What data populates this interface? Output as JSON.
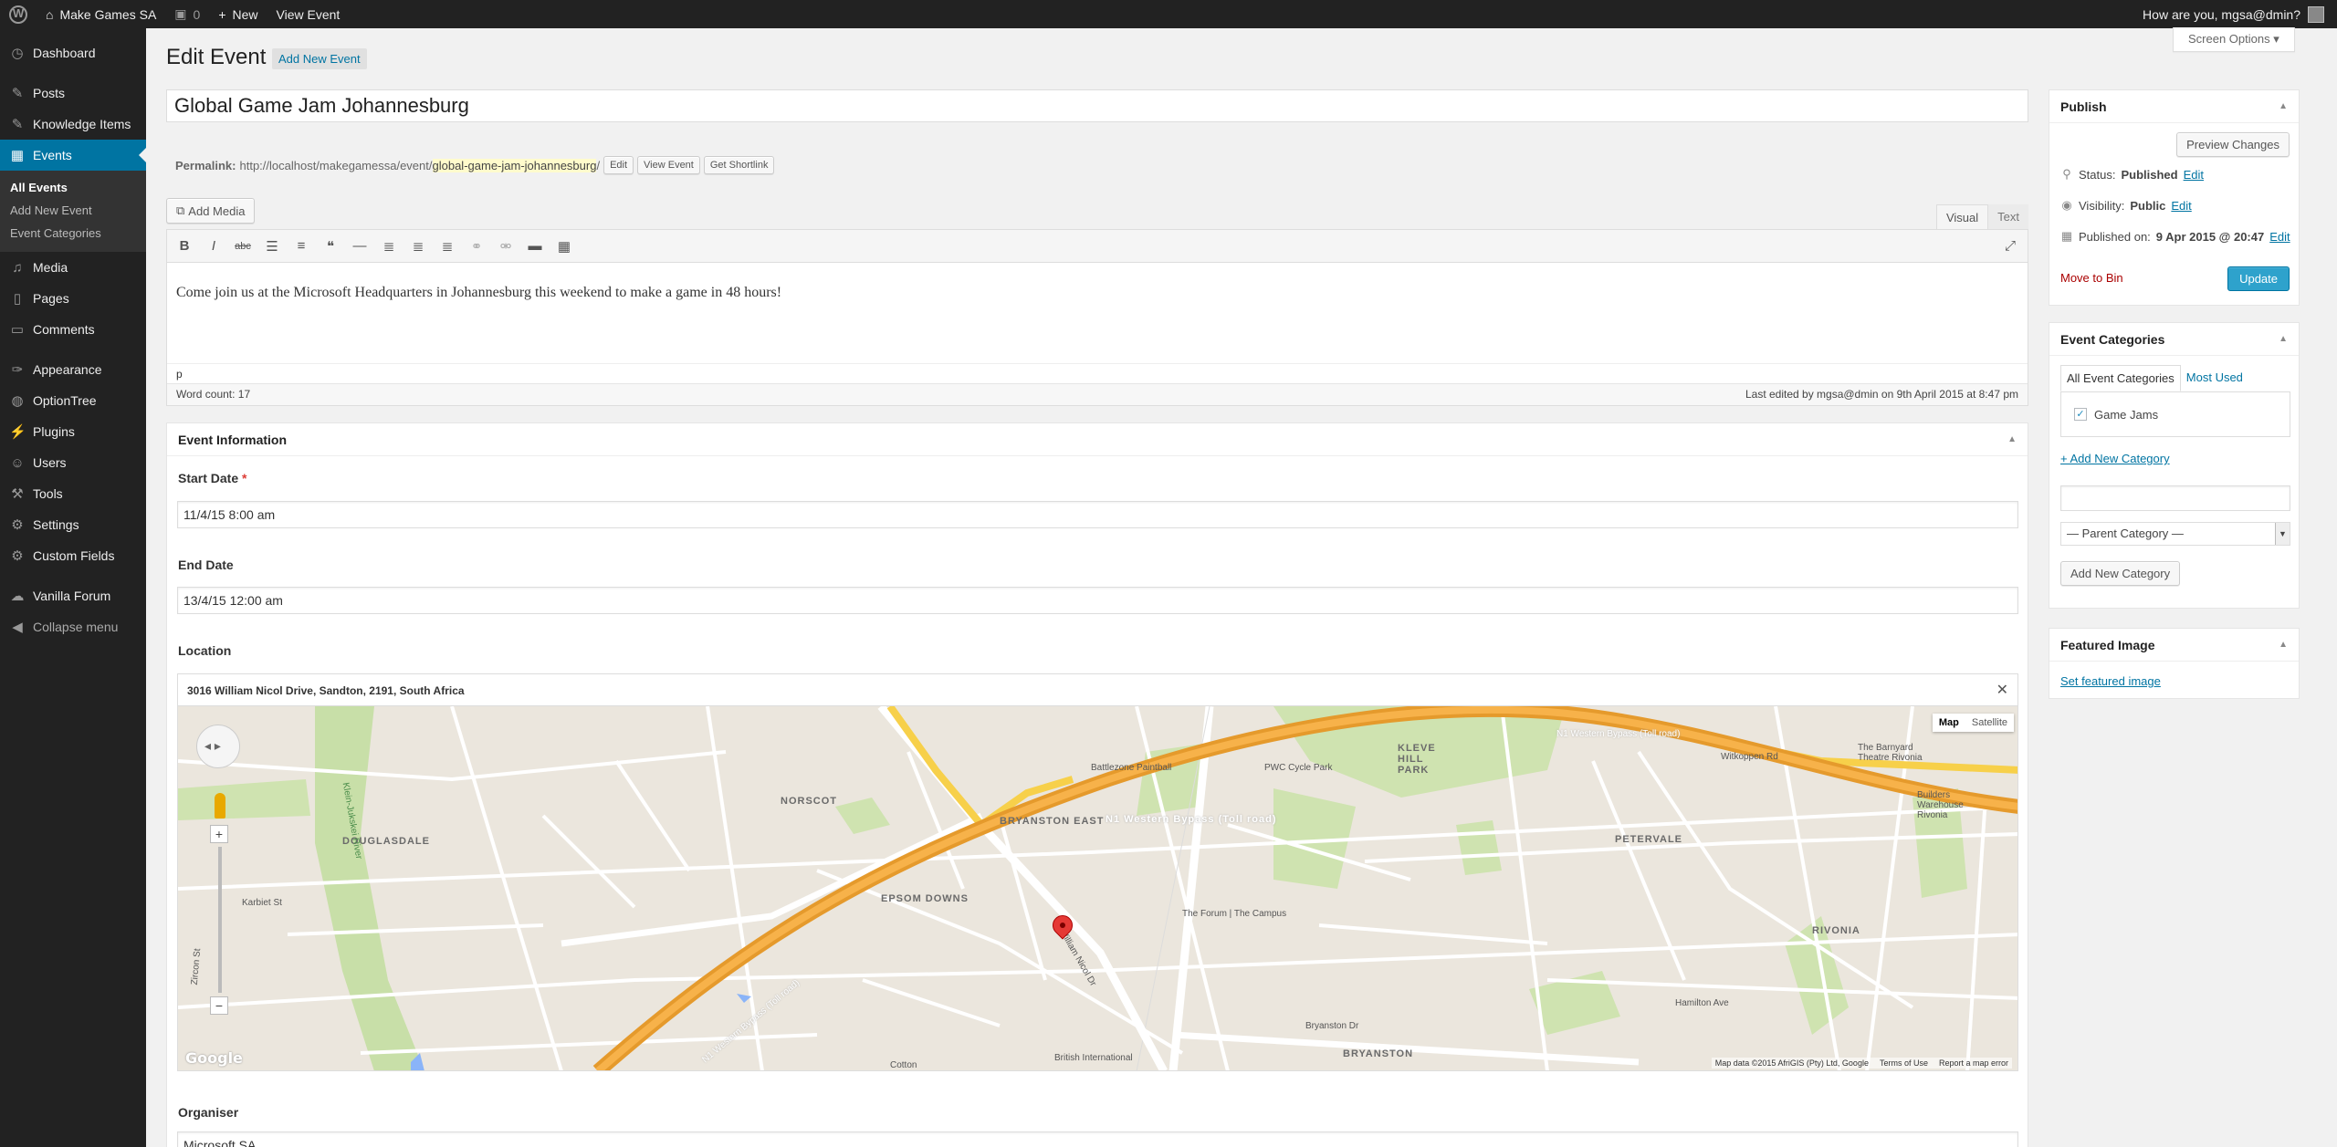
{
  "adminbar": {
    "site_name": "Make Games SA",
    "comments_count": "0",
    "new_label": "New",
    "view_event": "View Event",
    "greeting": "How are you, mgsa@dmin?"
  },
  "sidebar": {
    "dashboard": "Dashboard",
    "posts": "Posts",
    "knowledge_items": "Knowledge Items",
    "events": "Events",
    "events_sub": [
      "All Events",
      "Add New Event",
      "Event Categories"
    ],
    "media": "Media",
    "pages": "Pages",
    "comments": "Comments",
    "appearance": "Appearance",
    "optiontree": "OptionTree",
    "plugins": "Plugins",
    "users": "Users",
    "tools": "Tools",
    "settings": "Settings",
    "custom_fields": "Custom Fields",
    "vanilla_forum": "Vanilla Forum",
    "collapse": "Collapse menu"
  },
  "header": {
    "title": "Edit Event",
    "add_new": "Add New Event",
    "screen_options": "Screen Options"
  },
  "post": {
    "title": "Global Game Jam Johannesburg",
    "permalink_label": "Permalink:",
    "permalink_base": "http://localhost/makegamessa/event/",
    "permalink_slug": "global-game-jam-johannesburg",
    "permalink_end": "/",
    "edit_btn": "Edit",
    "view_btn": "View Event",
    "shortlink_btn": "Get Shortlink",
    "add_media": "Add Media",
    "tab_visual": "Visual",
    "tab_text": "Text",
    "content": "Come join us at the Microsoft Headquarters in Johannesburg this weekend to make a game in 48 hours!",
    "path": "p",
    "word_count": "Word count: 17",
    "last_edited": "Last edited by mgsa@dmin on 9th April 2015 at 8:47 pm"
  },
  "event_info": {
    "heading": "Event Information",
    "start_label": "Start Date",
    "start_required": "*",
    "start_value": "11/4/15 8:00 am",
    "end_label": "End Date",
    "end_value": "13/4/15 12:00 am",
    "location_label": "Location",
    "location_value": "3016 William Nicol Drive, Sandton, 2191, South Africa",
    "map_btn": "Map",
    "satellite_btn": "Satellite",
    "map_attrib": "Map data ©2015 AfriGIS (Pty) Ltd, Google",
    "map_terms": "Terms of Use",
    "map_report": "Report a map error",
    "google": "Google",
    "organiser_label": "Organiser",
    "organiser_value": "Microsoft SA",
    "map_labels": {
      "n1": "N1 Western Bypass (Toll road)",
      "n1b": "N1 Western Bypass (Toll road)",
      "n1c": "N1 Western Bypass (Toll road)",
      "bryanston_east": "BRYANSTON EAST",
      "epsom": "EPSOM DOWNS",
      "douglasdale": "DOUGLASDALE",
      "norscot": "NORSCOT",
      "peterdale": "PETERVALE",
      "rivonia": "RIVONIA",
      "bryanston": "BRYANSTON",
      "klevehill": "KLEVE HILL PARK",
      "forum": "The Forum | The Campus",
      "battlezone": "Battlezone Paintball",
      "pwc": "PWC Cycle Park",
      "william": "William Nicol Dr",
      "witkoppen": "Witkoppen Rd",
      "karbiet": "Karbiet St",
      "hamilton": "Hamilton Ave",
      "british": "British International",
      "barnyard": "The Barnyard Theatre Rivonia",
      "builders": "Builders Warehouse Rivonia",
      "bryanston_dr": "Bryanston Dr",
      "kleinjukskei": "Klein-Jukskei River",
      "zircon": "Zircon St",
      "cotton": "Cotton"
    }
  },
  "publish": {
    "heading": "Publish",
    "preview": "Preview Changes",
    "status_label": "Status:",
    "status_value": "Published",
    "visibility_label": "Visibility:",
    "visibility_value": "Public",
    "published_label": "Published on:",
    "published_value": "9 Apr 2015 @ 20:47",
    "edit": "Edit",
    "trash": "Move to Bin",
    "update": "Update"
  },
  "categories": {
    "heading": "Event Categories",
    "tab_all": "All Event Categories",
    "tab_most": "Most Used",
    "item": "Game Jams",
    "add_link": "+ Add New Category",
    "parent_select": "— Parent Category —",
    "add_btn": "Add New Category"
  },
  "featured": {
    "heading": "Featured Image",
    "set_link": "Set featured image"
  },
  "colors": {
    "accent": "#0074a2",
    "primary_button": "#2ea2cc",
    "admin_bar": "#222222",
    "trash": "#aa0000"
  }
}
